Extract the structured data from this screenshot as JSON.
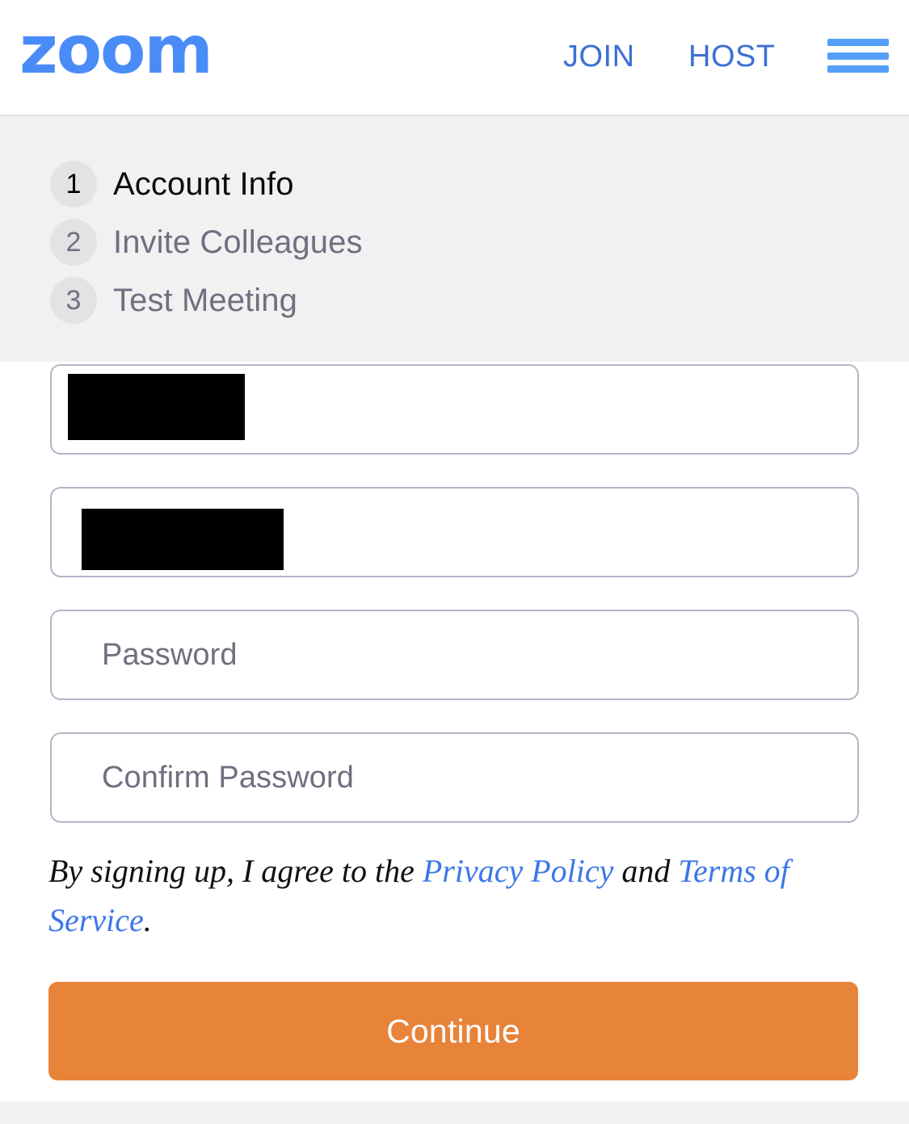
{
  "header": {
    "logo_text": "zoom",
    "logo_color": "#4A8CF7",
    "nav": [
      {
        "label": "JOIN",
        "name": "join-link"
      },
      {
        "label": "HOST",
        "name": "host-link"
      }
    ],
    "menu_icon": "hamburger-menu-icon",
    "menu_color": "#54A0F8"
  },
  "steps": {
    "items": [
      {
        "number": "1",
        "label": "Account Info",
        "active": true
      },
      {
        "number": "2",
        "label": "Invite Colleagues",
        "active": false
      },
      {
        "number": "3",
        "label": "Test Meeting",
        "active": false
      }
    ],
    "panel_bg": "#F1F1F1",
    "circle_bg": "#E3E3E3",
    "inactive_color": "#6F6F80"
  },
  "form": {
    "fields": [
      {
        "name": "first-name-field",
        "placeholder": "",
        "value": "",
        "redacted": true
      },
      {
        "name": "last-name-field",
        "placeholder": "",
        "value": "",
        "redacted": true
      },
      {
        "name": "password-field",
        "placeholder": "Password",
        "value": "",
        "redacted": false
      },
      {
        "name": "confirm-password-field",
        "placeholder": "Confirm Password",
        "value": "",
        "redacted": false
      }
    ],
    "border_color": "#B5B5C8",
    "placeholder_color": "#6F6F80"
  },
  "terms": {
    "prefix": "By signing up, I agree to the ",
    "privacy_policy": "Privacy Policy",
    "conjunction": " and ",
    "terms_of_service": "Terms of Service",
    "suffix": ".",
    "link_color": "#3B77E8"
  },
  "actions": {
    "continue_label": "Continue",
    "continue_bg": "#E8833A",
    "continue_text_color": "#FFFFFF"
  }
}
